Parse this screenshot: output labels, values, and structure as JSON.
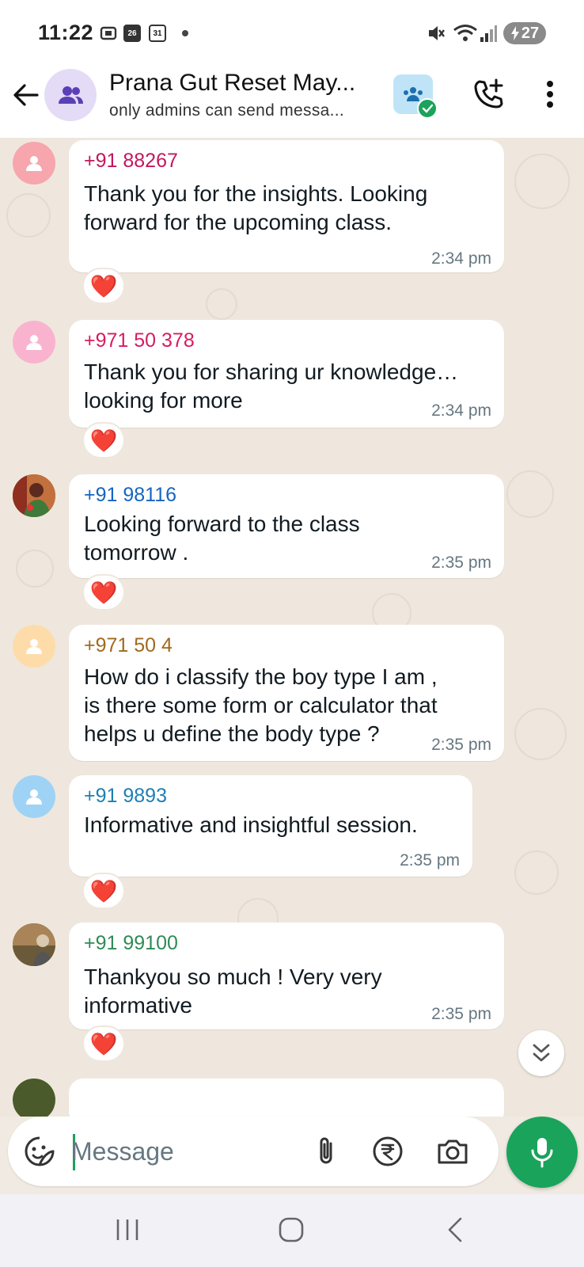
{
  "status_bar": {
    "time": "11:22",
    "calendar_icon_1": "26",
    "calendar_icon_2": "31",
    "battery": "27",
    "icons": [
      "screenshot-icon",
      "calendar-icon",
      "calendar-icon",
      "mute-icon",
      "wifi-icon",
      "signal-icon",
      "battery-icon"
    ]
  },
  "header": {
    "title": "Prana Gut Reset May...",
    "subtitle": "only admins can send messa...",
    "icons": [
      "back-arrow-icon",
      "group-icon",
      "community-icon",
      "add-call-icon",
      "more-vert-icon"
    ]
  },
  "messages": [
    {
      "sender": "+91 88267",
      "sender_color": "#c2185b",
      "avatar_bg": "#f7a6ad",
      "avatar_type": "default",
      "text": "Thank you for the insights. Looking\nforward  for the upcoming class.",
      "time": "2:34 pm",
      "reaction": "❤️"
    },
    {
      "sender": "+971 50 378",
      "sender_color": "#d81b60",
      "avatar_bg": "#f9b3cf",
      "avatar_type": "default",
      "text": "Thank you for sharing ur knowledge…\nlooking for more",
      "time": "2:34 pm",
      "reaction": "❤️"
    },
    {
      "sender": "+91 98116",
      "sender_color": "#1565c0",
      "avatar_bg": "#b4523a",
      "avatar_type": "photo",
      "text": "Looking forward to the class\ntomorrow .",
      "time": "2:35 pm",
      "reaction": "❤️"
    },
    {
      "sender": "+971 50 4",
      "sender_color": "#a06a1c",
      "avatar_bg": "#fddcaa",
      "avatar_type": "default",
      "text": "How do i classify the boy type I am ,\nis there some form or calculator that\nhelps u define the body type ?",
      "time": "2:35 pm",
      "reaction": ""
    },
    {
      "sender": "+91 9893",
      "sender_color": "#1e7fb3",
      "avatar_bg": "#9fd3f5",
      "avatar_type": "default",
      "text": "Informative and insightful session.",
      "time": "2:35 pm",
      "reaction": "❤️"
    },
    {
      "sender": "+91 99100",
      "sender_color": "#2e8b57",
      "avatar_bg": "#8a6a4a",
      "avatar_type": "photo",
      "text": "Thankyou so much ! Very very\ninformative",
      "time": "2:35 pm",
      "reaction": "❤️"
    }
  ],
  "composer": {
    "placeholder": "Message",
    "icons": [
      "sticker-icon",
      "attach-icon",
      "rupee-icon",
      "camera-icon",
      "mic-icon"
    ]
  },
  "nav": {
    "icons": [
      "recent-apps-icon",
      "home-icon",
      "back-icon"
    ]
  },
  "colors": {
    "accent_green": "#1aa35a",
    "chat_background": "#efe7dd",
    "heart": "#e53935"
  }
}
